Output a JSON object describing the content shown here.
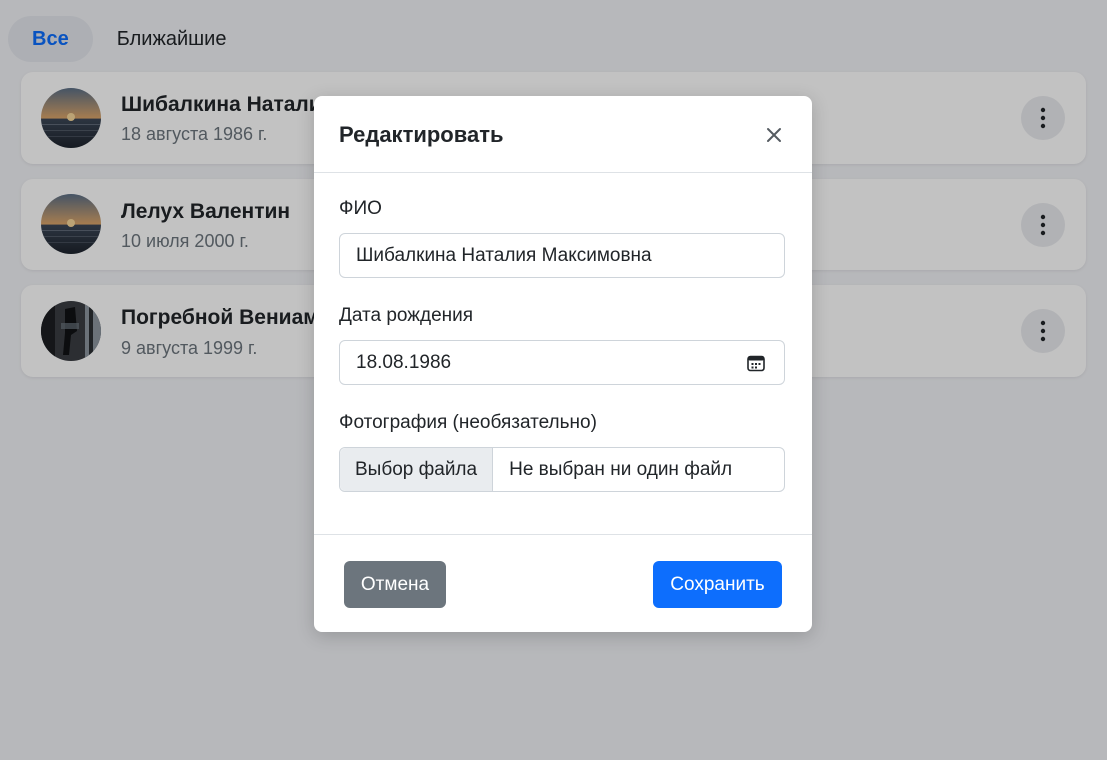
{
  "tabs": [
    {
      "label": "Все",
      "active": true
    },
    {
      "label": "Ближайшие",
      "active": false
    }
  ],
  "people": [
    {
      "name": "Шибалкина Наталия Максимовна",
      "date": "18 августа 1986 г.",
      "avatar": "sunset-sea-photo"
    },
    {
      "name": "Лелух Валентин",
      "date": "10 июля 2000 г.",
      "avatar": "sunset-sea-photo"
    },
    {
      "name": "Погребной Вениамин",
      "date": "9 августа 1999 г.",
      "avatar": "dark-figure-photo"
    }
  ],
  "modal": {
    "title": "Редактировать",
    "close_icon": "close-icon",
    "fields": {
      "fio_label": "ФИО",
      "fio_value": "Шибалкина Наталия Максимовна",
      "birth_label": "Дата рождения",
      "birth_value": "18.08.1986",
      "photo_label": "Фотография (необязательно)",
      "file_button": "Выбор файла",
      "file_status": "Не выбран ни один файл"
    },
    "cancel_label": "Отмена",
    "save_label": "Сохранить"
  },
  "colors": {
    "accent": "#0d6efd",
    "secondary": "#6c757d"
  }
}
